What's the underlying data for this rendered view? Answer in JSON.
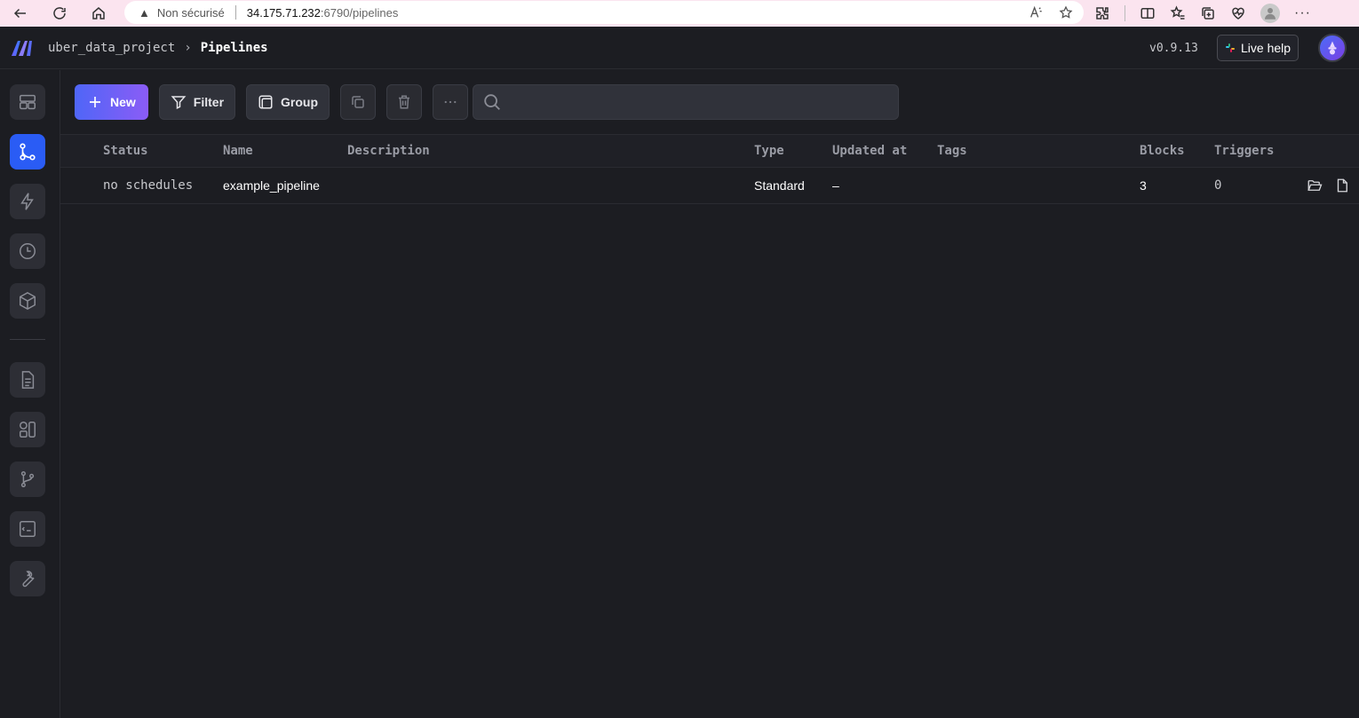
{
  "browser": {
    "insecure_label": "Non sécurisé",
    "url_host": "34.175.71.232",
    "url_path": ":6790/pipelines"
  },
  "header": {
    "project": "uber_data_project",
    "current_page": "Pipelines",
    "version": "v0.9.13",
    "live_help": "Live help"
  },
  "toolbar": {
    "new_label": "New",
    "filter_label": "Filter",
    "group_label": "Group",
    "search_placeholder": ""
  },
  "table": {
    "columns": [
      "Status",
      "Name",
      "Description",
      "Type",
      "Updated at",
      "Tags",
      "Blocks",
      "Triggers"
    ],
    "rows": [
      {
        "status": "no schedules",
        "name": "example_pipeline",
        "description": "",
        "type": "Standard",
        "updated_at": "–",
        "tags": "",
        "blocks": "3",
        "triggers": "0"
      }
    ]
  },
  "colors": {
    "accent": "#2a5cf5",
    "background": "#1c1d22",
    "primary_gradient_start": "#4f66f7",
    "primary_gradient_end": "#8b5cf6"
  }
}
